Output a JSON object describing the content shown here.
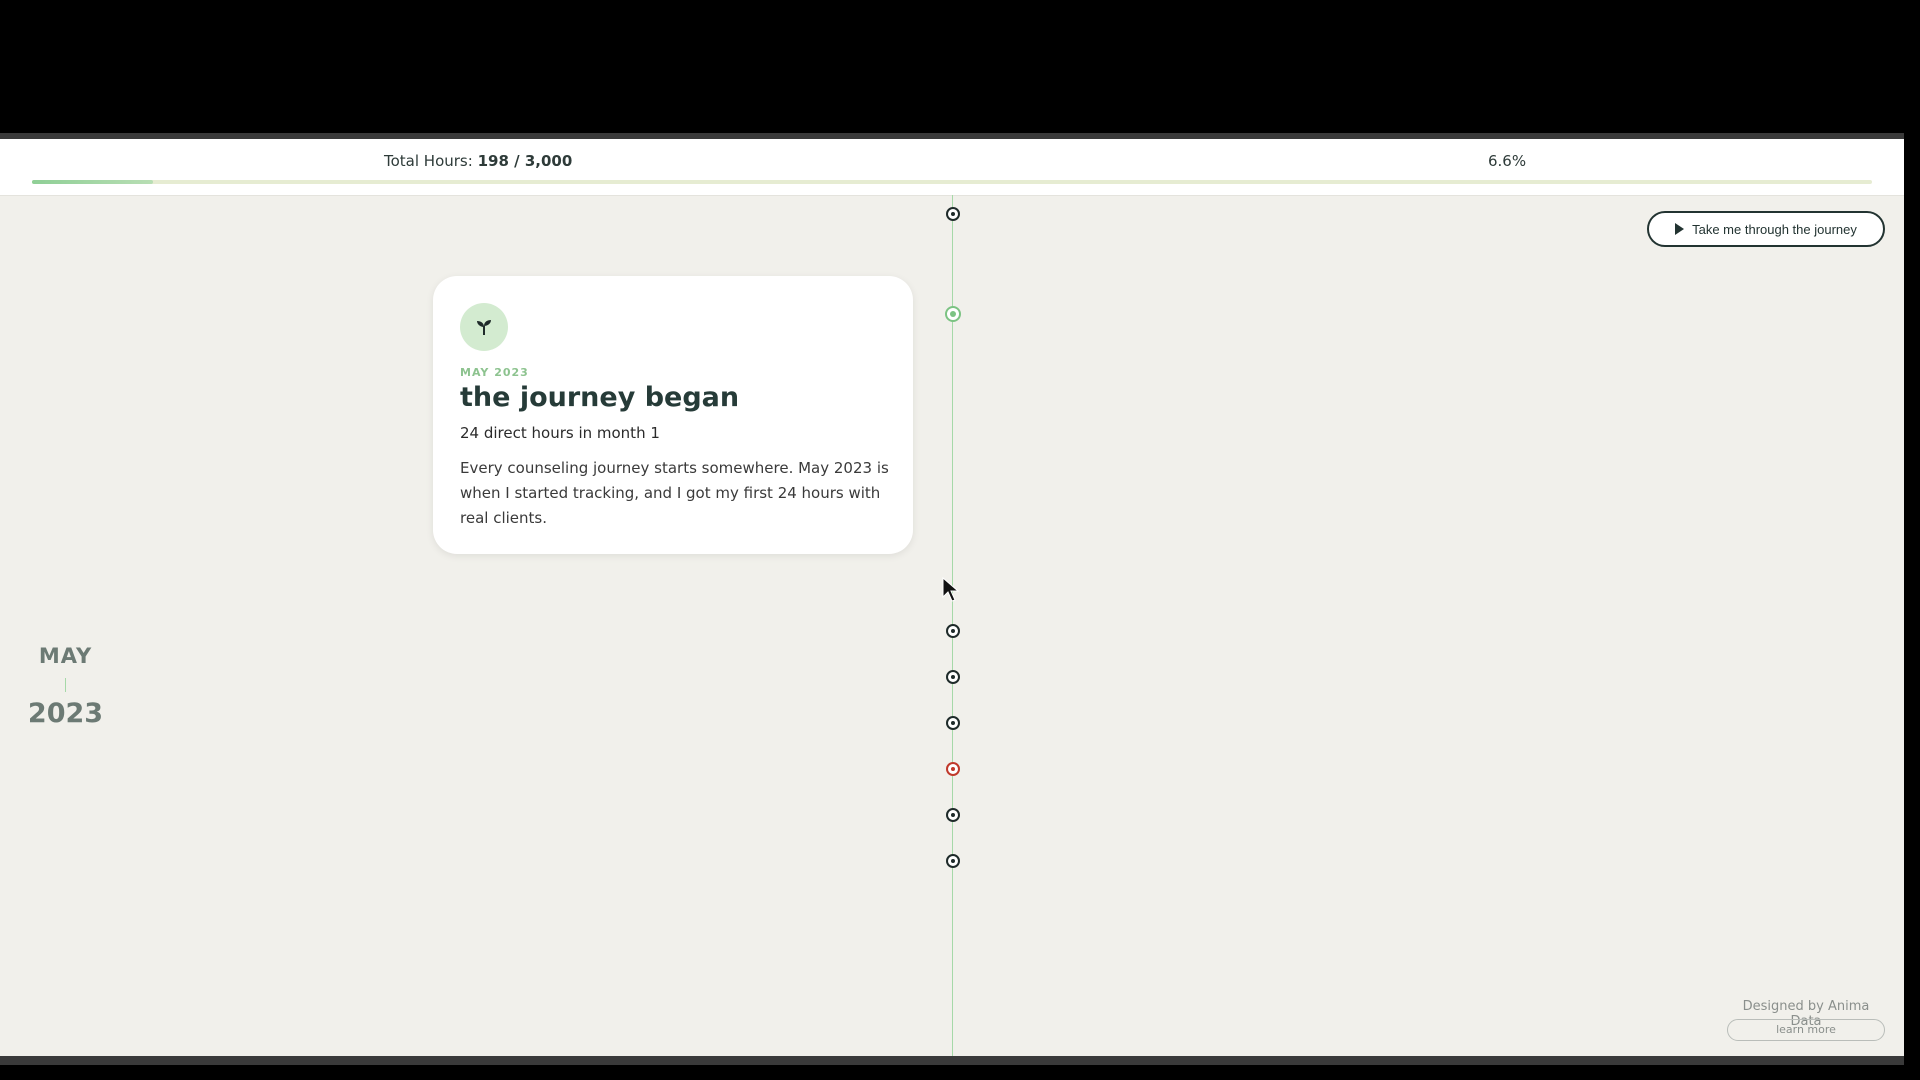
{
  "progress": {
    "hours_prefix": "Total Hours:",
    "hours_value": "198 / 3,000",
    "percent_label": "6.6%",
    "fraction": 0.066
  },
  "card": {
    "icon": "sprout-icon",
    "date": "MAY 2023",
    "title": "the journey began",
    "subtitle": "24 direct hours in month 1",
    "body": "Every counseling journey starts somewhere. May 2023 is when I started tracking, and I got my first 24 hours with real clients."
  },
  "side_label": {
    "month": "MAY",
    "year": "2023"
  },
  "journey_button": {
    "label": "Take me through the journey",
    "icon": "play-icon"
  },
  "credit": {
    "text": "Designed by Anima Data",
    "learn_more": "learn more"
  },
  "colors": {
    "accent_green": "#7cc383",
    "alert_red": "#c0392b",
    "dark": "#223331",
    "background": "#f1f0eb"
  }
}
